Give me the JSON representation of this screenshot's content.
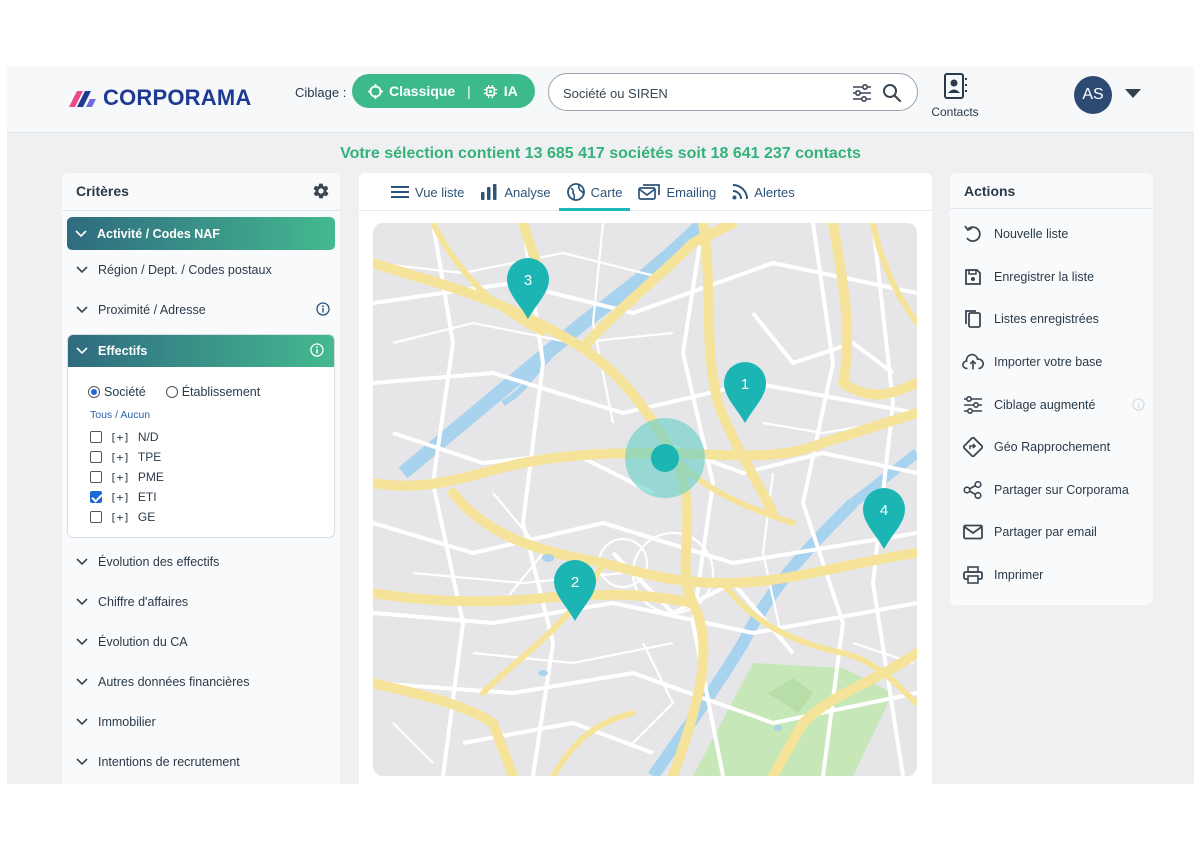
{
  "header": {
    "brand": "CORPORAMA",
    "ciblage_label": "Ciblage :",
    "ciblage_options": [
      "Classique",
      "IA"
    ],
    "ciblage_separator": "|",
    "search_placeholder": "Société ou SIREN",
    "contacts_label": "Contacts",
    "avatar_initials": "AS"
  },
  "summary": "Votre sélection contient 13 685 417 sociétés soit 18 641 237 contacts",
  "criteria": {
    "title": "Critères",
    "items_top": [
      {
        "label": "Activité / Codes NAF"
      },
      {
        "label": "Région / Dept. / Codes postaux"
      },
      {
        "label": "Proximité / Adresse"
      }
    ],
    "effectifs": {
      "label": "Effectifs",
      "radio_options": [
        "Société",
        "Établissement"
      ],
      "selected_radio": "Société",
      "tous_aucun": "Tous / Aucun",
      "prefix": "[+]",
      "options": [
        {
          "label": "N/D",
          "checked": false
        },
        {
          "label": "TPE",
          "checked": false
        },
        {
          "label": "PME",
          "checked": false
        },
        {
          "label": "ETI",
          "checked": true
        },
        {
          "label": "GE",
          "checked": false
        }
      ]
    },
    "items_bottom": [
      {
        "label": "Évolution des effectifs"
      },
      {
        "label": "Chiffre d'affaires"
      },
      {
        "label": "Évolution du CA"
      },
      {
        "label": "Autres données financières"
      },
      {
        "label": "Immobilier"
      },
      {
        "label": "Intentions de recrutement"
      }
    ]
  },
  "tabs": [
    {
      "label": "Vue liste",
      "icon": "list-icon"
    },
    {
      "label": "Analyse",
      "icon": "bar-chart-icon"
    },
    {
      "label": "Carte",
      "icon": "globe-icon"
    },
    {
      "label": "Emailing",
      "icon": "mail-icon"
    },
    {
      "label": "Alertes",
      "icon": "rss-icon"
    }
  ],
  "active_tab": "Carte",
  "map": {
    "markers": [
      "1",
      "2",
      "3",
      "4"
    ]
  },
  "actions": {
    "title": "Actions",
    "items": [
      {
        "label": "Nouvelle liste",
        "icon": "undo-icon"
      },
      {
        "label": "Enregistrer la liste",
        "icon": "save-icon"
      },
      {
        "label": "Listes enregistrées",
        "icon": "copy-icon"
      },
      {
        "label": "Importer votre base",
        "icon": "cloud-upload-icon"
      },
      {
        "label": "Ciblage augmenté",
        "icon": "sliders-icon"
      },
      {
        "label": "Géo Rapprochement",
        "icon": "directions-icon"
      },
      {
        "label": "Partager sur Corporama",
        "icon": "share-icon"
      },
      {
        "label": "Partager par email",
        "icon": "envelope-icon"
      },
      {
        "label": "Imprimer",
        "icon": "printer-icon"
      }
    ]
  },
  "colors": {
    "brand_blue": "#1f3a93",
    "accent_green": "#3dba8c",
    "teal": "#1fb8b8",
    "summary_green": "#35b17a"
  }
}
